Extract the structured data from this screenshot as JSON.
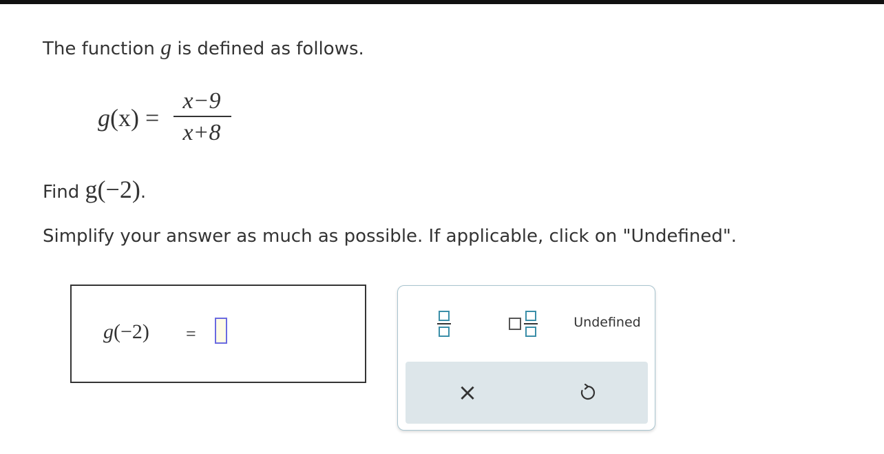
{
  "question": {
    "intro_prefix": "The function",
    "intro_var": "g",
    "intro_suffix": "is defined as follows.",
    "definition": {
      "lhs_name": "g",
      "lhs_arg": "(x)",
      "equals": "=",
      "numerator": "x−9",
      "denominator": "x+8"
    },
    "find_label": "Find",
    "find_expr": "g(−2)",
    "find_end": ".",
    "instruction": "Simplify your answer as much as possible. If applicable, click on \"Undefined\"."
  },
  "answer": {
    "expr_name": "g",
    "expr_arg": "(−2)",
    "equals": "="
  },
  "keypad": {
    "fraction_button": "fraction-icon",
    "mixed_number_button": "mixed-number-icon",
    "undefined_label": "Undefined",
    "clear_symbol": "×",
    "undo_icon": "undo-icon"
  },
  "colors": {
    "input_border": "#6a6ae0",
    "input_fill": "#fffbe6",
    "keypad_border": "#a8c4cf",
    "template_square": "#3a8ea8",
    "action_bar": "#dde6ea"
  }
}
